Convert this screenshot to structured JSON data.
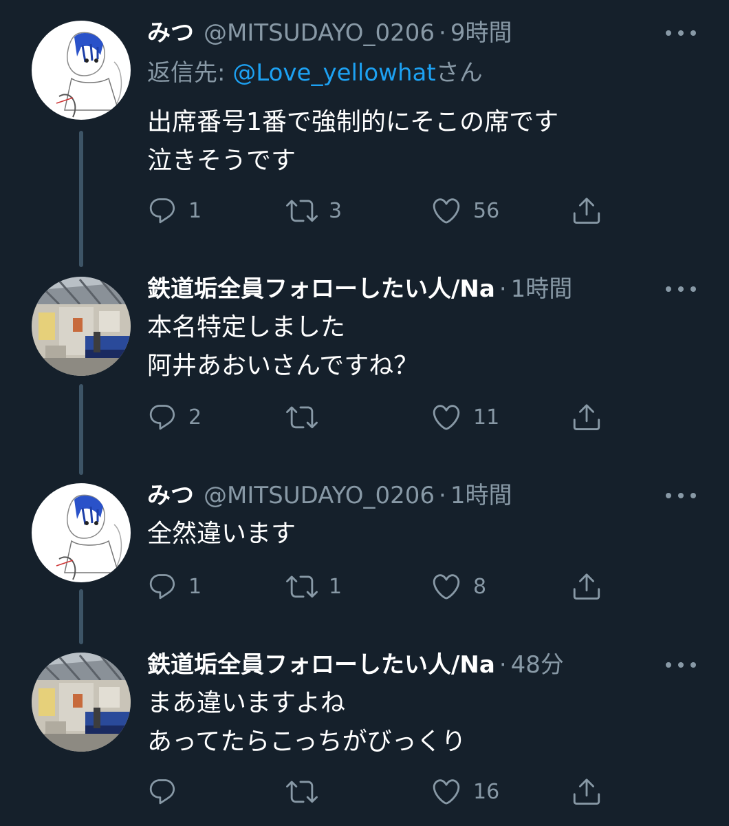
{
  "tweets": [
    {
      "name": "みつ",
      "handle": "@MITSUDAYO_0206",
      "time": "9時間",
      "reply_prefix": "返信先: ",
      "reply_mention": "@Love_yellowhat",
      "reply_suffix": "さん",
      "lines": [
        "出席番号1番で強制的にそこの席です",
        "泣きそうです"
      ],
      "reply_count": "1",
      "retweet_count": "3",
      "like_count": "56"
    },
    {
      "name": "鉄道垢全員フォローしたい人/Na",
      "handle": "",
      "time": "1時間",
      "lines": [
        "本名特定しました",
        "阿井あおいさんですね？"
      ],
      "reply_count": "2",
      "retweet_count": "",
      "like_count": "11"
    },
    {
      "name": "みつ",
      "handle": "@MITSUDAYO_0206",
      "time": "1時間",
      "lines": [
        "全然違います"
      ],
      "reply_count": "1",
      "retweet_count": "1",
      "like_count": "8"
    },
    {
      "name": "鉄道垢全員フォローしたい人/Na",
      "handle": "",
      "time": "48分",
      "lines": [
        "まあ違いますよね",
        "あってたらこっちがびっくり"
      ],
      "reply_count": "",
      "retweet_count": "",
      "like_count": "16"
    }
  ],
  "icons": {
    "reply": "reply-icon",
    "retweet": "retweet-icon",
    "like": "heart-icon",
    "share": "share-icon",
    "more": "more-icon"
  },
  "colors": {
    "background": "#15202b",
    "secondary_text": "#8899a6",
    "link": "#1da1f2",
    "thread_line": "#3d5466"
  }
}
